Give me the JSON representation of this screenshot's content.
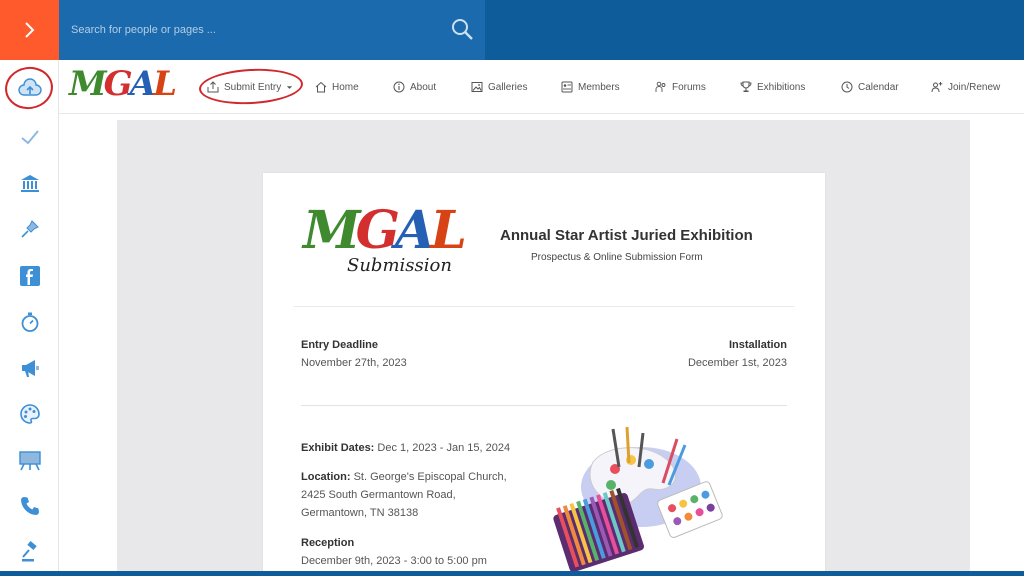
{
  "search": {
    "placeholder": "Search for people or pages ..."
  },
  "brand": {
    "m": "M",
    "g": "G",
    "a": "A",
    "l": "L"
  },
  "sidebar": {
    "items": [
      {
        "icon": "cloud-upload-icon"
      },
      {
        "icon": "check-icon"
      },
      {
        "icon": "museum-icon"
      },
      {
        "icon": "pin-icon"
      },
      {
        "icon": "facebook-icon"
      },
      {
        "icon": "stopwatch-icon"
      },
      {
        "icon": "megaphone-icon"
      },
      {
        "icon": "palette-icon"
      },
      {
        "icon": "easel-icon"
      },
      {
        "icon": "phone-icon"
      },
      {
        "icon": "gavel-icon"
      }
    ]
  },
  "nav": {
    "submit": "Submit Entry",
    "home": "Home",
    "about": "About",
    "galleries": "Galleries",
    "members": "Members",
    "forums": "Forums",
    "exhibitions": "Exhibitions",
    "calendar": "Calendar",
    "join": "Join/Renew"
  },
  "card": {
    "logo_sub": "Submission",
    "title": "Annual Star Artist Juried Exhibition",
    "subtitle": "Prospectus & Online Submission Form",
    "deadline_label": "Entry Deadline",
    "deadline_value": "November 27th, 2023",
    "install_label": "Installation",
    "install_value": "December 1st, 2023",
    "exhibit_label": "Exhibit Dates:",
    "exhibit_value": "Dec 1, 2023 - Jan 15, 2024",
    "location_label": "Location:",
    "location_line1": "St. George's Episcopal Church,",
    "location_line2": "2425 South Germantown Road,",
    "location_line3": "Germantown, TN 38138",
    "reception_label": "Reception",
    "reception_value": "December 9th, 2023 - 3:00 to 5:00 pm"
  },
  "colors": {
    "topbar": "#0e5c99",
    "accent": "#ff5a2b",
    "icon_blue": "#3d8fd6",
    "annotation_red": "#d0282c"
  }
}
